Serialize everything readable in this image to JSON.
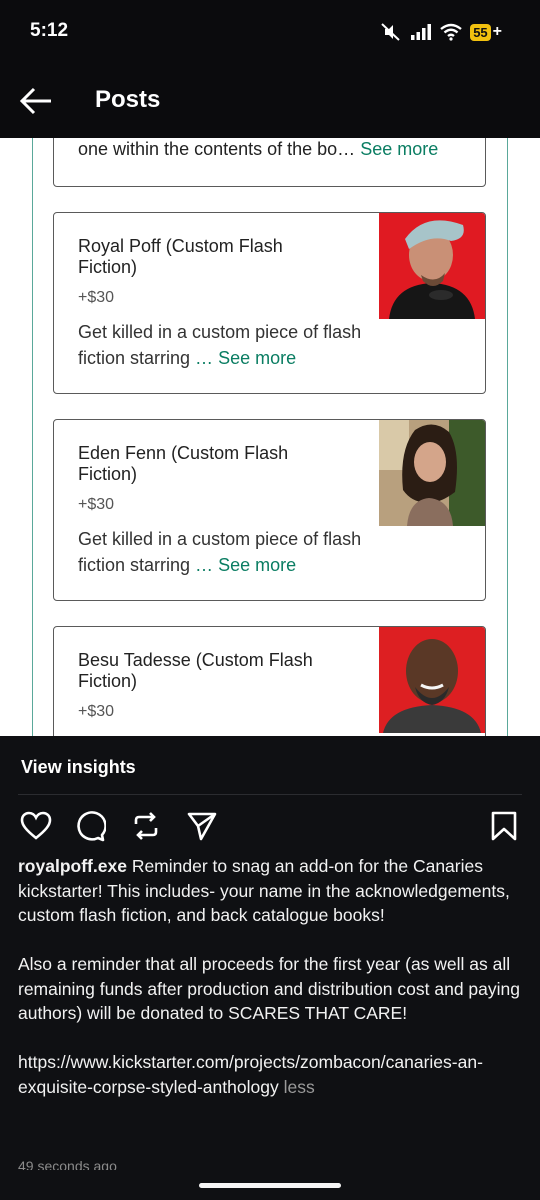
{
  "status_bar": {
    "time": "5:12",
    "battery": "55"
  },
  "header": {
    "title": "Posts"
  },
  "cards": {
    "previous": {
      "desc": "one within the contents of the bo…",
      "see_more": "See more"
    },
    "items": [
      {
        "title": "Royal Poff (Custom Flash Fiction)",
        "price": "+$30",
        "desc": "Get killed in a custom piece of flash fiction starring",
        "ellipsis": " …",
        "see_more": "See more"
      },
      {
        "title": "Eden Fenn (Custom Flash Fiction)",
        "price": "+$30",
        "desc": "Get killed in a custom piece of flash fiction starring",
        "ellipsis": " …",
        "see_more": "See more"
      },
      {
        "title": "Besu Tadesse (Custom Flash Fiction)",
        "price": "+$30"
      }
    ]
  },
  "post": {
    "insights_label": "View insights",
    "username": "royalpoff.exe",
    "caption_p1": "Reminder to snag an add-on for the Canaries kickstarter! This includes- your name in the acknowledgements, custom flash fiction, and back catalogue books!",
    "caption_p2": "Also a reminder that all proceeds for the first year (as well as all remaining funds after production and distribution cost and paying authors) will be donated to SCARES THAT CARE!",
    "link": "https://www.kickstarter.com/projects/zombacon/canaries-an-exquisite-corpse-styled-anthology",
    "less_label": "less",
    "timestamp": "49 seconds ago"
  },
  "icons": [
    "back-arrow-icon",
    "heart-icon",
    "comment-icon",
    "repost-icon",
    "share-icon",
    "bookmark-icon",
    "mute-icon",
    "signal-icon",
    "wifi-icon",
    "battery-icon"
  ],
  "colors": {
    "accent": "#0a7d62",
    "panel": "#0f1013",
    "battery": "#f2c10f"
  }
}
